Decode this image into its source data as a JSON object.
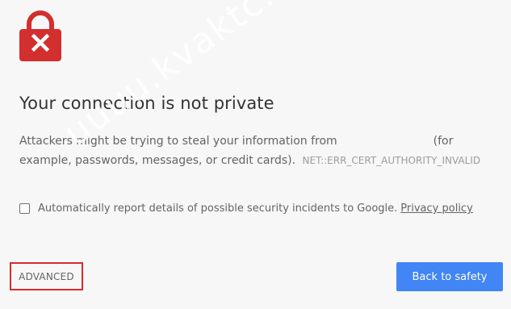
{
  "interstitial": {
    "title": "Your connection is not private",
    "body_before_host": "Attackers might be trying to steal your information from",
    "body_after_host": "(for example, passwords, messages, or credit cards).",
    "error_code": "NET::ERR_CERT_AUTHORITY_INVALID",
    "report_text": "Automatically report details of possible security incidents to Google.",
    "privacy_link": "Privacy policy",
    "advanced_label": "ADVANCED",
    "safety_label": "Back to safety",
    "report_checked": false
  },
  "watermark": "uuuu.kvaktc.com",
  "colors": {
    "lock_red": "#d32f2f",
    "button_blue": "#4285f4",
    "highlight_border": "#d92b2b",
    "background": "#f7f7f7"
  },
  "icons": {
    "lock": "lock-error-icon"
  }
}
